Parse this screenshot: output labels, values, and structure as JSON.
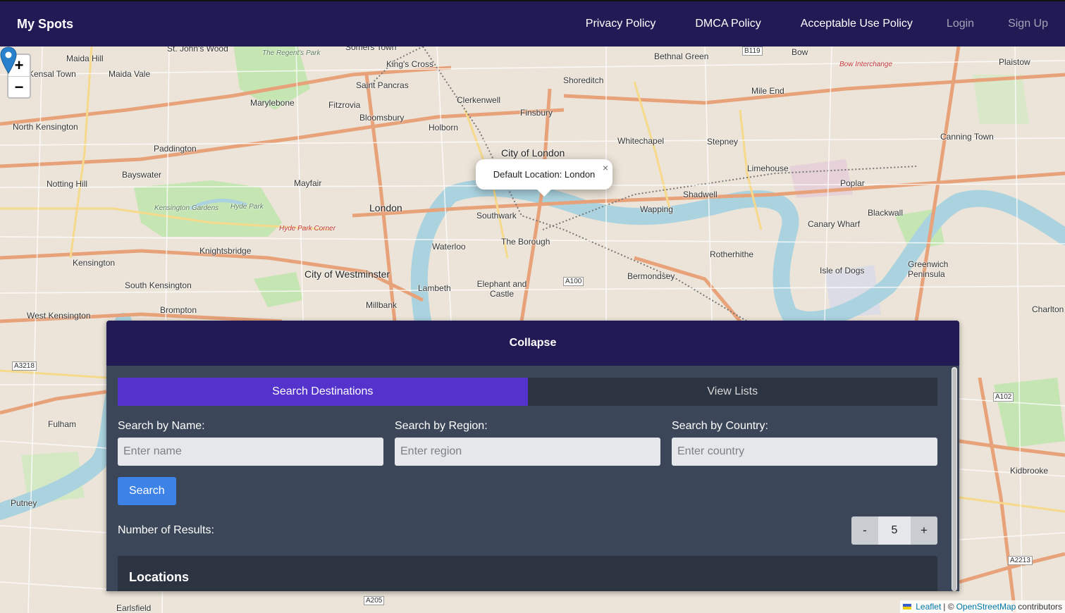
{
  "navbar": {
    "brand": "My Spots",
    "links": [
      "Privacy Policy",
      "DMCA Policy",
      "Acceptable Use Policy"
    ],
    "login": "Login",
    "signup": "Sign Up"
  },
  "map": {
    "zoom_in": "+",
    "zoom_out": "−",
    "popup_text": "Default Location: London",
    "popup_close": "×",
    "attribution": {
      "leaflet": "Leaflet",
      "separator": "| ©",
      "osm": "OpenStreetMap",
      "suffix": "contributors"
    },
    "labels": [
      "Maida Hill",
      "Maida Vale",
      "St. John's Wood",
      "Somers Town",
      "King's Cross",
      "Shoreditch",
      "Bethnal Green",
      "Bow",
      "Plaistow",
      "Kensal Town",
      "Marylebone",
      "Fitzrovia",
      "Saint Pancras",
      "Clerkenwell",
      "Finsbury",
      "Mile End",
      "North Kensington",
      "Bloomsbury",
      "Holborn",
      "Whitechapel",
      "Stepney",
      "Canning Town",
      "Paddington",
      "City of London",
      "Limehouse",
      "Bayswater",
      "Mayfair",
      "Notting Hill",
      "London",
      "Southwark",
      "Shadwell",
      "Poplar",
      "Wapping",
      "Blackwall",
      "Canary Wharf",
      "The Borough",
      "Knightsbridge",
      "Waterloo",
      "Rotherhithe",
      "Kensington",
      "Isle of Dogs",
      "Greenwich Peninsula",
      "City of Westminster",
      "Bermondsey",
      "South Kensington",
      "Lambeth",
      "Elephant and Castle",
      "Brompton",
      "Millbank",
      "West Kensington",
      "Charlton",
      "Fulham",
      "Kidbrooke",
      "Putney",
      "Earlsfield"
    ],
    "green_labels": [
      "The Regent's Park",
      "Kensington Gardens",
      "Hyde Park"
    ],
    "red_labels": [
      "Bow Interchange",
      "Hyde Park Corner"
    ],
    "road_labels": [
      "B119",
      "A100",
      "A3218",
      "A102",
      "A2213",
      "A205"
    ]
  },
  "panel": {
    "collapse_label": "Collapse",
    "tabs": [
      {
        "label": "Search Destinations",
        "active": true
      },
      {
        "label": "View Lists",
        "active": false
      }
    ],
    "fields": [
      {
        "label": "Search by Name:",
        "placeholder": "Enter name",
        "value": ""
      },
      {
        "label": "Search by Region:",
        "placeholder": "Enter region",
        "value": ""
      },
      {
        "label": "Search by Country:",
        "placeholder": "Enter country",
        "value": ""
      }
    ],
    "search_button": "Search",
    "results_label": "Number of Results:",
    "results_count": "5",
    "decrement": "-",
    "increment": "+",
    "locations_heading": "Locations"
  },
  "colors": {
    "navbar_bg": "#221a55",
    "tab_active": "#5433cc",
    "search_button": "#3d82e6",
    "panel_bg": "#3b4758"
  }
}
